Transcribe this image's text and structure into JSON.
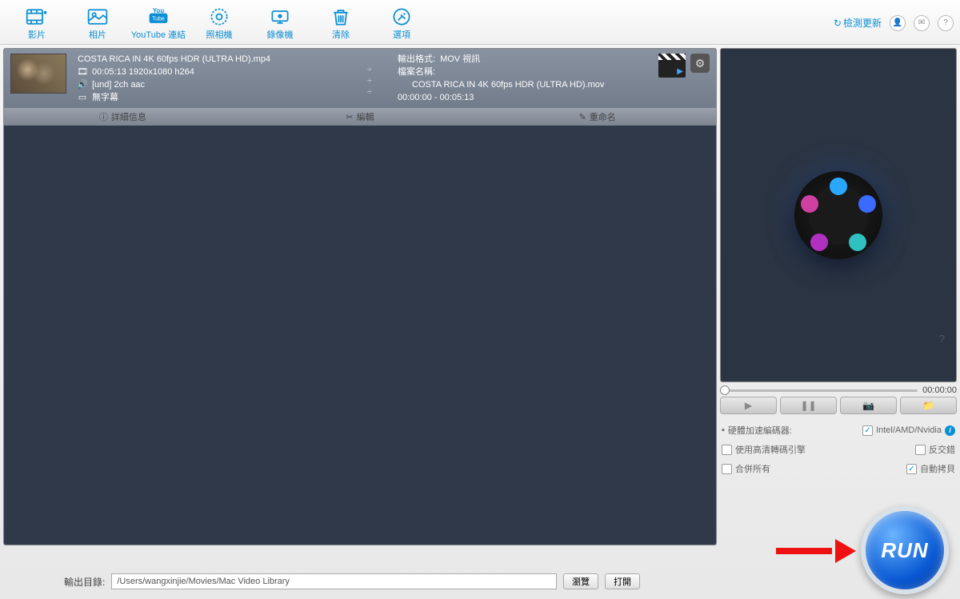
{
  "toolbar": {
    "items": [
      {
        "label": "影片",
        "icon": "video"
      },
      {
        "label": "相片",
        "icon": "photo"
      },
      {
        "label": "YouTube 連結",
        "icon": "youtube"
      },
      {
        "label": "照相機",
        "icon": "camera"
      },
      {
        "label": "錄像機",
        "icon": "recorder"
      },
      {
        "label": "清除",
        "icon": "trash"
      },
      {
        "label": "選項",
        "icon": "options"
      }
    ],
    "check_update": "檢測更新"
  },
  "file": {
    "name": "COSTA RICA IN 4K 60fps HDR (ULTRA HD).mp4",
    "video_info": "00:05:13 1920x1080 h264",
    "audio_info": "[und] 2ch aac",
    "subtitle_info": "無字幕",
    "sep": "÷",
    "out_format_label": "輸出格式: ",
    "out_format_value": "MOV 視訊",
    "out_name_label": "檔案名稱:",
    "out_name_value": "COSTA RICA IN 4K 60fps HDR (ULTRA HD).mov",
    "time_range": "00:00:00 - 00:05:13",
    "actions": {
      "detail": "詳細信息",
      "edit": "編輯",
      "rename": "重命名"
    }
  },
  "preview": {
    "time": "00:00:00",
    "question": "?",
    "hw_label": "硬體加速編碼器:",
    "hw_value": "Intel/AMD/Nvidia",
    "hq_label": "使用高清轉碼引擎",
    "deint_label": "反交錯",
    "merge_label": "合併所有",
    "autocopy_label": "自動拷貝"
  },
  "run": {
    "label": "RUN"
  },
  "output": {
    "label": "輸出目錄:",
    "path": "/Users/wangxinjie/Movies/Mac Video Library",
    "browse": "瀏覽",
    "open": "打開"
  }
}
